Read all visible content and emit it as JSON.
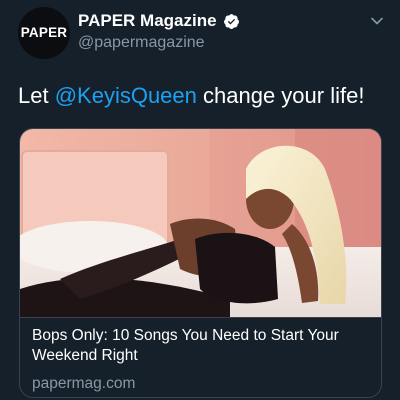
{
  "tweet": {
    "avatar_text": "PAPER",
    "display_name": "PAPER Magazine",
    "handle": "@papermagazine",
    "text_prefix": "Let ",
    "mention": "@KeyisQueen",
    "text_suffix": " change your life!"
  },
  "card": {
    "title": "Bops Only: 10 Songs You Need to Start Your Weekend Right",
    "domain": "papermag.com"
  },
  "icons": {
    "verified": "verified-badge-icon",
    "menu": "chevron-down-icon"
  },
  "colors": {
    "background": "#15202b",
    "link": "#1da1f2",
    "secondary_text": "#8899a6",
    "border": "#38444d"
  }
}
